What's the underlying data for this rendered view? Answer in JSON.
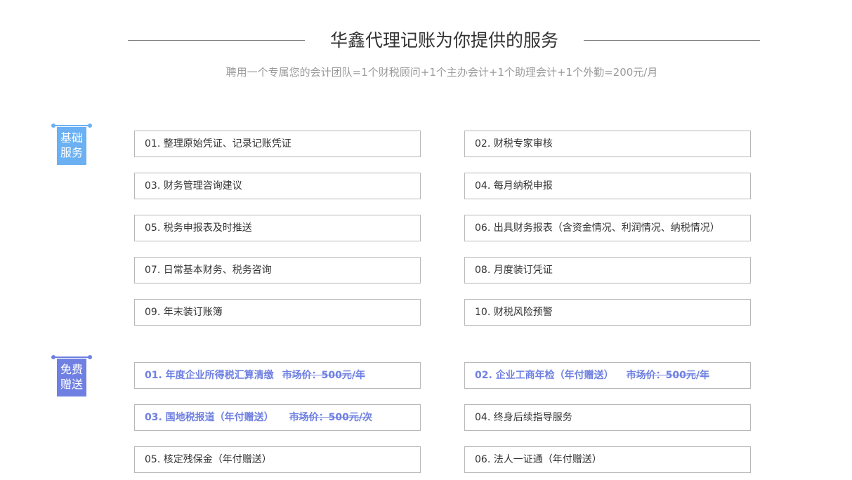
{
  "header": {
    "title": "华鑫代理记账为你提供的服务",
    "subtitle": "聘用一个专属您的会计团队=1个财税顾问+1个主办会计+1个助理会计+1个外勤=200元/月"
  },
  "colors": {
    "basic_tag": "#6ab0f3",
    "free_tag": "#6f80e2",
    "highlight_text": "#6f80e2",
    "box_border": "#b8b8b8"
  },
  "basic": {
    "tag_line1": "基础",
    "tag_line2": "服务",
    "items": [
      "01. 整理原始凭证、记录记账凭证",
      "02. 财税专家审核",
      "03. 财务管理咨询建议",
      "04. 每月纳税申报",
      "05. 税务申报表及时推送",
      "06. 出具财务报表（含资金情况、利润情况、纳税情况）",
      "07. 日常基本财务、税务咨询",
      "08. 月度装订凭证",
      "09. 年末装订账簿",
      "10. 财税风险预警"
    ]
  },
  "free": {
    "tag_line1": "免费",
    "tag_line2": "赠送",
    "items": [
      {
        "label": "01. 年度企业所得税汇算清缴",
        "price": "市场价：500元/年"
      },
      {
        "label": "02. 企业工商年检（年付赠送）",
        "price": "市场价：500元/年"
      },
      {
        "label": "03. 国地税报道（年付赠送）",
        "price": "市场价：500元/次"
      },
      {
        "label": "04. 终身后续指导服务"
      },
      {
        "label": "05. 核定残保金（年付赠送）"
      },
      {
        "label": "06. 法人一证通（年付赠送）"
      }
    ]
  }
}
